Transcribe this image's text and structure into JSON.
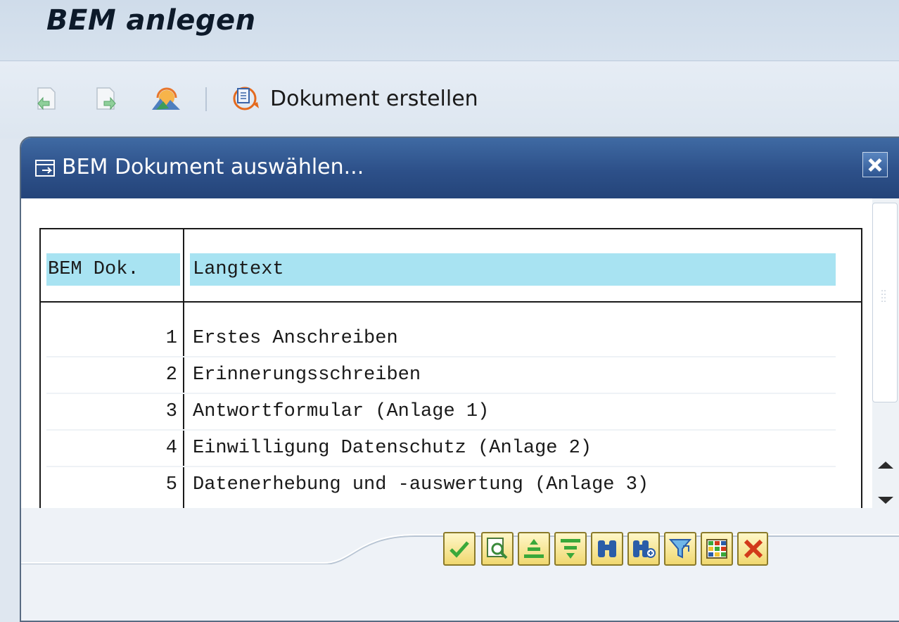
{
  "window": {
    "title": "BEM anlegen"
  },
  "toolbar": {
    "icons": [
      "back-page-icon",
      "forward-page-icon",
      "landscape-image-icon"
    ],
    "document_create_label": "Dokument erstellen"
  },
  "dialog": {
    "title": "BEM Dokument auswählen...",
    "table": {
      "columns": [
        "BEM Dok.",
        "Langtext"
      ],
      "rows": [
        {
          "number": "1",
          "text": "Erstes Anschreiben"
        },
        {
          "number": "2",
          "text": "Erinnerungsschreiben"
        },
        {
          "number": "3",
          "text": "Antwortformular (Anlage 1)"
        },
        {
          "number": "4",
          "text": "Einwilligung Datenschutz (Anlage 2)"
        },
        {
          "number": "5",
          "text": "Datenerhebung und -auswertung (Anlage 3)"
        }
      ]
    },
    "footer_buttons": [
      "confirm-check-icon",
      "details-magnify-icon",
      "sort-ascending-icon",
      "sort-descending-icon",
      "find-binoculars-icon",
      "find-next-binoculars-icon",
      "filter-funnel-icon",
      "layout-grid-icon",
      "cancel-x-icon"
    ]
  },
  "colors": {
    "dialog_header": "#2d5089",
    "table_header": "#a8e3f2",
    "button_face": "#f0d870",
    "confirm_green": "#3aa83a",
    "cancel_red": "#d23a1a"
  }
}
